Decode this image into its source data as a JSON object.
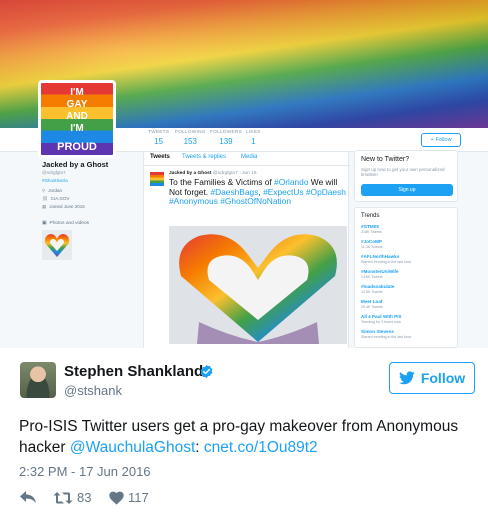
{
  "embedded_profile": {
    "banner_label": "rainbow-flag-banner",
    "avatar": {
      "line1": "I'M",
      "line2": "GAY",
      "line3": "AND",
      "line4": "I'M",
      "line5": "PROUD"
    },
    "stats": [
      {
        "label": "TWEETS",
        "value": "15"
      },
      {
        "label": "FOLLOWING",
        "value": "153"
      },
      {
        "label": "FOLLOWERS",
        "value": "139"
      },
      {
        "label": "LIKES",
        "value": "1"
      }
    ],
    "follow_label": "Follow",
    "name": "Jacked by a Ghost",
    "handle": "@ndrgfgto7",
    "hashtag": "#GhostSecla",
    "location": "Jordan",
    "link": "CIA.GOV",
    "joined": "Joined June 2016",
    "photos_label": "Photos and videos",
    "tabs": [
      "Tweets",
      "Tweets & replies",
      "Media"
    ],
    "tweet": {
      "name": "Jacked by a Ghost",
      "meta": "@ndrgfgto7 · Jun 16",
      "text_plain_1": "To the Families & Victims of ",
      "tag_orlando": "#Orlando",
      "text_plain_2": " We will Not forget. ",
      "tag_daesh": "#DaeshBags",
      "tag_expect": "#ExpectUs",
      "tag_opdaesh": "#OpDaesh",
      "tag_anon": "#Anonymous",
      "tag_ghost": "#GhostOfNoNation"
    },
    "new_to_twitter": {
      "title": "New to Twitter?",
      "subtitle": "Sign up now to get your own personalized timeline!",
      "signup": "Sign up"
    },
    "trends": {
      "title": "Trends",
      "items": [
        {
          "tag": "#GTM05",
          "meta": "218K Tweets"
        },
        {
          "tag": "#JoCoMP",
          "meta": "11.3K Tweets"
        },
        {
          "tag": "#AFLNorthHawks",
          "meta": "Started trending in the last hour"
        },
        {
          "tag": "#MonsterUniWife",
          "meta": "14.6K Tweets"
        },
        {
          "tag": "#loadsoabulate",
          "meta": "14.5K Tweets"
        },
        {
          "tag": "Meet Loaf",
          "meta": "29.4K Tweets"
        },
        {
          "tag": "All 4 Paul With PIX",
          "meta": "Trending for 3 hours now"
        },
        {
          "tag": "Simon Stevens",
          "meta": "Started trending in the last hour"
        }
      ]
    }
  },
  "tweet": {
    "author_name": "Stephen Shankland",
    "author_handle": "@stshank",
    "follow_label": "Follow",
    "text_main": "Pro-ISIS Twitter users get a pro-gay makeover from Anonymous hacker ",
    "mention": "@WauchulaGhost",
    "link": "cnet.co/1Ou89t2",
    "timestamp": "2:32 PM - 17 Jun 2016",
    "retweets": "83",
    "likes": "117"
  },
  "colors": {
    "accent": "#1da1f2",
    "text": "#14171a",
    "muted": "#657786"
  },
  "icons": [
    "verified-badge-icon",
    "twitter-bird-icon",
    "reply-icon",
    "retweet-icon",
    "heart-icon"
  ]
}
